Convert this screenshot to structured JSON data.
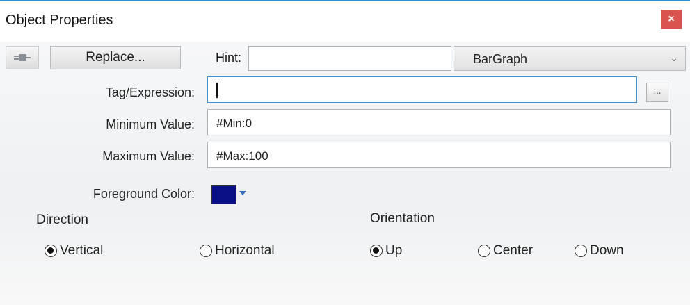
{
  "window": {
    "title": "Object Properties",
    "close_label": "×"
  },
  "toolbar": {
    "plug_icon": "plug-icon",
    "replace_label": "Replace...",
    "hint_label": "Hint:",
    "hint_value": "",
    "object_type": "BarGraph",
    "dropdown_icon": "chevron-down-icon"
  },
  "fields": {
    "tag_label": "Tag/Expression:",
    "tag_value": "",
    "browse_label": "...",
    "min_label": "Minimum Value:",
    "min_value": "#Min:0",
    "max_label": "Maximum Value:",
    "max_value": "#Max:100",
    "fg_label": "Foreground Color:",
    "fg_color": "#0a1186"
  },
  "direction": {
    "label": "Direction",
    "options": [
      {
        "label": "Vertical",
        "checked": true
      },
      {
        "label": "Horizontal",
        "checked": false
      }
    ]
  },
  "orientation": {
    "label": "Orientation",
    "options": [
      {
        "label": "Up",
        "checked": true
      },
      {
        "label": "Center",
        "checked": false
      },
      {
        "label": "Down",
        "checked": false
      }
    ]
  }
}
